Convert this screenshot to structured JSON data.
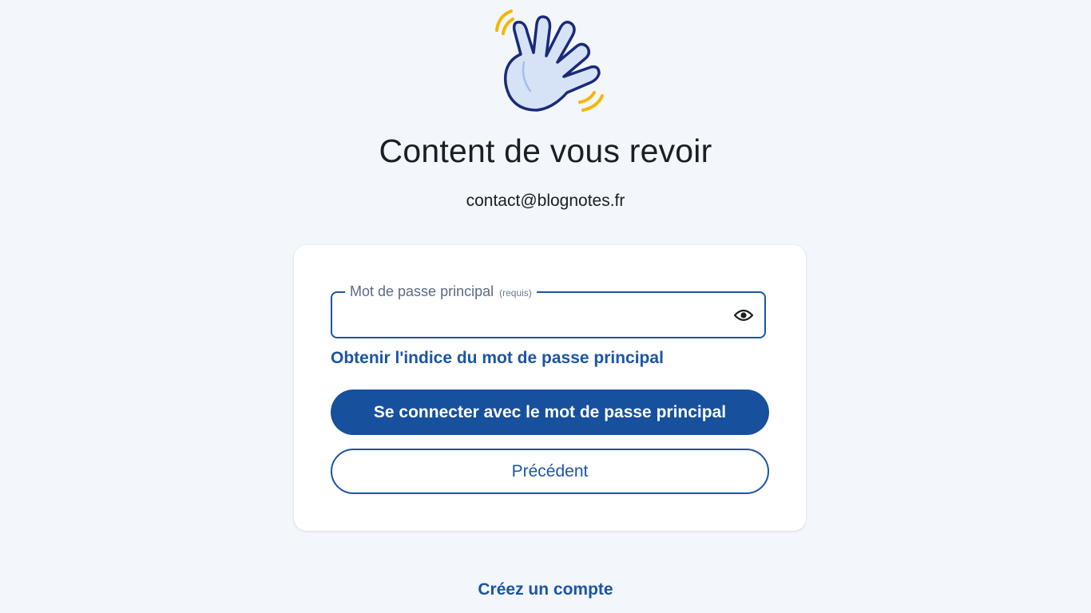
{
  "header": {
    "title": "Content de vous revoir",
    "email": "contact@blognotes.fr"
  },
  "form": {
    "password_label": "Mot de passe principal",
    "password_required": "(requis)",
    "password_value": "",
    "hint_link": "Obtenir l'indice du mot de passe principal",
    "login_button": "Se connecter avec le mot de passe principal",
    "back_button": "Précédent"
  },
  "footer": {
    "create_account": "Créez un compte"
  },
  "colors": {
    "accent": "#1b55a6",
    "button_primary": "#17509c",
    "background": "#f3f6fa",
    "wave_lines": "#f5b700"
  },
  "icons": {
    "hero": "waving-hand-icon",
    "toggle": "eye-icon"
  }
}
